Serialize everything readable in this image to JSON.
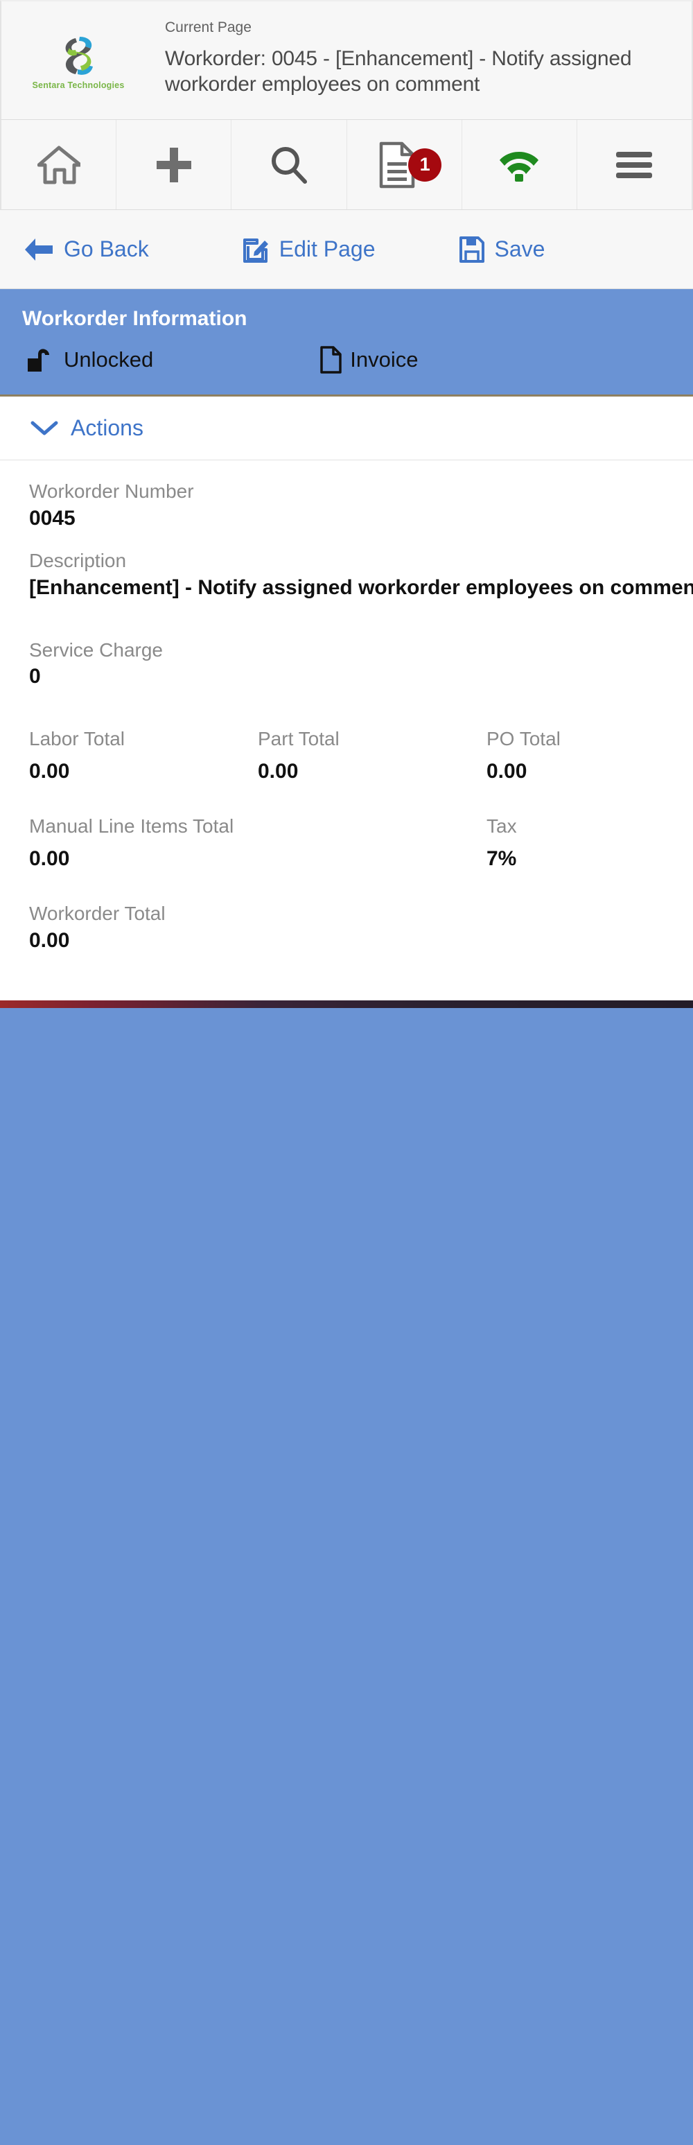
{
  "header": {
    "logo_name": "Sentara Technologies",
    "current_page_label": "Current Page",
    "page_title": "Workorder: 0045 - [Enhancement] - Notify assigned workorder employees on comment"
  },
  "toolbar": {
    "items": [
      {
        "icon": "home-icon",
        "name": "home"
      },
      {
        "icon": "plus-icon",
        "name": "add"
      },
      {
        "icon": "search-icon",
        "name": "search"
      },
      {
        "icon": "document-icon",
        "name": "documents",
        "badge": "1"
      },
      {
        "icon": "wifi-icon",
        "name": "connection"
      },
      {
        "icon": "hamburger-icon",
        "name": "menu"
      }
    ],
    "badge_count": "1",
    "badge_color": "#a5090f",
    "wifi_color": "#1f8a1f"
  },
  "action_bar": {
    "go_back": "Go Back",
    "edit_page": "Edit Page",
    "save": "Save",
    "link_color": "#3e74c8"
  },
  "section": {
    "title": "Workorder Information",
    "banner_color": "#6a93d4",
    "lock_status": "Unlocked",
    "invoice": "Invoice",
    "actions_label": "Actions"
  },
  "fields": {
    "workorder_number_label": "Workorder Number",
    "workorder_number_value": "0045",
    "description_label": "Description",
    "description_value": "[Enhancement] - Notify assigned workorder employees on comment",
    "service_charge_label": "Service Charge",
    "service_charge_value": "0",
    "labor_total_label": "Labor Total",
    "labor_total_value": "0.00",
    "part_total_label": "Part Total",
    "part_total_value": "0.00",
    "po_total_label": "PO Total",
    "po_total_value": "0.00",
    "manual_line_items_total_label": "Manual Line Items Total",
    "manual_line_items_total_value": "0.00",
    "tax_label": "Tax",
    "tax_value": "7%",
    "workorder_total_label": "Workorder Total",
    "workorder_total_value": "0.00"
  }
}
